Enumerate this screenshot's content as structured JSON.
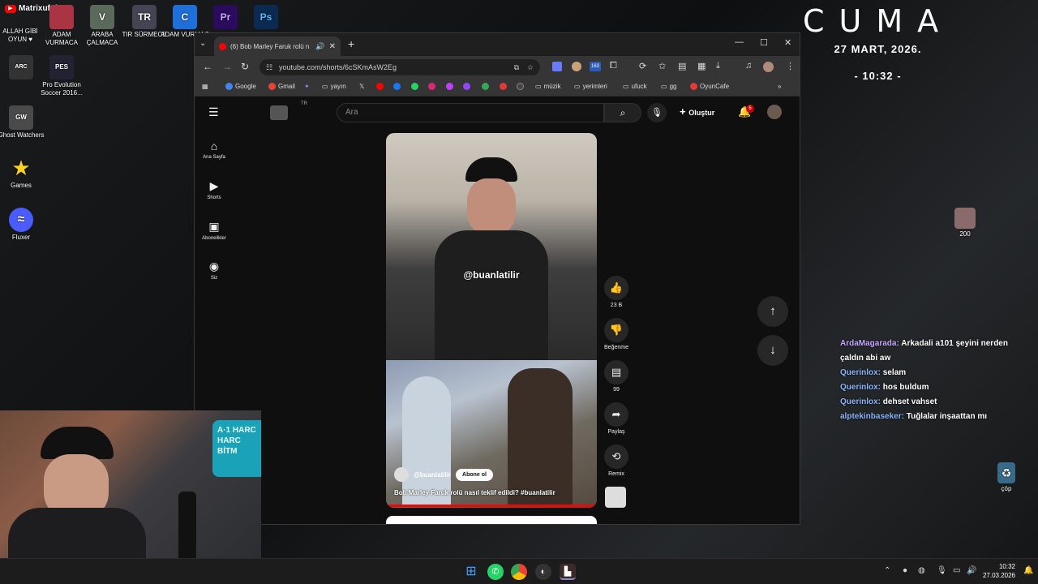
{
  "desktop": {
    "icons": [
      {
        "label": "Matrixufuk",
        "glyph": "▶",
        "color": "#ff0000"
      },
      {
        "label": "ALLAH GİBİ OYUN ♥",
        "glyph": "",
        "color": "#333"
      },
      {
        "label": "ADAM VURMACA",
        "glyph": "",
        "color": "#aa3344"
      },
      {
        "label": "ARABA ÇALMACA",
        "glyph": "V",
        "color": "#5a6a5a"
      },
      {
        "label": "TIR SÜRMECE",
        "glyph": "TR",
        "color": "#445"
      },
      {
        "label": "ADAM VURMAC",
        "glyph": "C",
        "color": "#1e6fd9"
      },
      {
        "label": "Premiere Pro",
        "glyph": "Pr",
        "color": "#2a0b5e"
      },
      {
        "label": "Photoshop",
        "glyph": "Ps",
        "color": "#0a2a52"
      },
      {
        "label": "ARC Raiders",
        "glyph": "ARC",
        "color": "#333"
      },
      {
        "label": "Pro Evolution Soccer 2016...",
        "glyph": "PES",
        "color": "#223"
      },
      {
        "label": "Ghost Watchers",
        "glyph": "GW",
        "color": "#4a4a4a"
      },
      {
        "label": "Games",
        "glyph": "★",
        "color": "transparent"
      },
      {
        "label": "Fluxer",
        "glyph": "≈",
        "color": "#4b5cff"
      },
      {
        "label": "200",
        "glyph": "",
        "color": "#8a6a6a"
      },
      {
        "label": "çöp",
        "glyph": "♻",
        "color": "#3a6a8a"
      }
    ]
  },
  "clock": {
    "day": "CUMA",
    "date": "27 MART, 2026.",
    "time": "- 10:32 -"
  },
  "browser": {
    "tab_title": "(6) Bob Marley Faruk rolü n",
    "url": "youtube.com/shorts/6cSKmAsW2Eg",
    "bookmarks": [
      "Google",
      "Gmail",
      "yayın",
      "müzik",
      "yerimleri",
      "ufuck",
      "gg",
      "OyunCafe"
    ],
    "ext_badge": "163"
  },
  "youtube": {
    "country": "TR",
    "search_placeholder": "Ara",
    "create_label": "Oluştur",
    "notif_count": "6",
    "sidebar": [
      {
        "label": "Ana Sayfa",
        "icon": "home-icon"
      },
      {
        "label": "Shorts",
        "icon": "shorts-icon"
      },
      {
        "label": "Abonelikler",
        "icon": "subscriptions-icon"
      },
      {
        "label": "Siz",
        "icon": "you-icon"
      }
    ],
    "short": {
      "watermark": "@buanlatilir",
      "channel": "@buanlatilir",
      "subscribe": "Abone ol",
      "title": "Bob Marley Faruk rolü nasıl teklif edildi? #buanlatilir"
    },
    "actions": {
      "likes": "23 B",
      "dislike": "Beğenme",
      "comments": "99",
      "share": "Paylaş",
      "remix": "Remix"
    }
  },
  "chat": [
    {
      "user": "ArdaMagarada:",
      "msg": "Arkadali a101 şeyini nerden çaldın abi aw",
      "cls": "u1"
    },
    {
      "user": "Querinlox:",
      "msg": "selam",
      "cls": "u2"
    },
    {
      "user": "Querinlox:",
      "msg": "hos buldum",
      "cls": "u2"
    },
    {
      "user": "Querinlox:",
      "msg": "dehset vahset",
      "cls": "u2"
    },
    {
      "user": "alptekinbaseker:",
      "msg": "Tuğlalar inşaattan mı",
      "cls": "u2"
    }
  ],
  "webcam": {
    "sign_text": "A·1 HARC HARC BİTM"
  },
  "taskbar": {
    "time": "10:32",
    "date": "27.03.2026"
  }
}
